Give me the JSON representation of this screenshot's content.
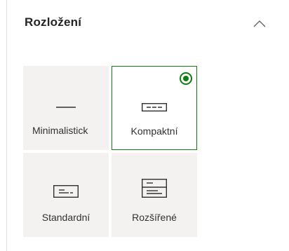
{
  "section": {
    "title": "Rozložení",
    "collapse_icon": "chevron-up-icon"
  },
  "layouts": [
    {
      "label": "Minimalistick",
      "icon": "minimal-layout-icon",
      "selected": false
    },
    {
      "label": "Kompaktní",
      "icon": "compact-layout-icon",
      "selected": true
    },
    {
      "label": "Standardní",
      "icon": "standard-layout-icon",
      "selected": false
    },
    {
      "label": "Rozšířené",
      "icon": "extended-layout-icon",
      "selected": false
    }
  ],
  "colors": {
    "accent": "#107c10",
    "tile_background": "#f3f2f1",
    "text": "#252423"
  }
}
